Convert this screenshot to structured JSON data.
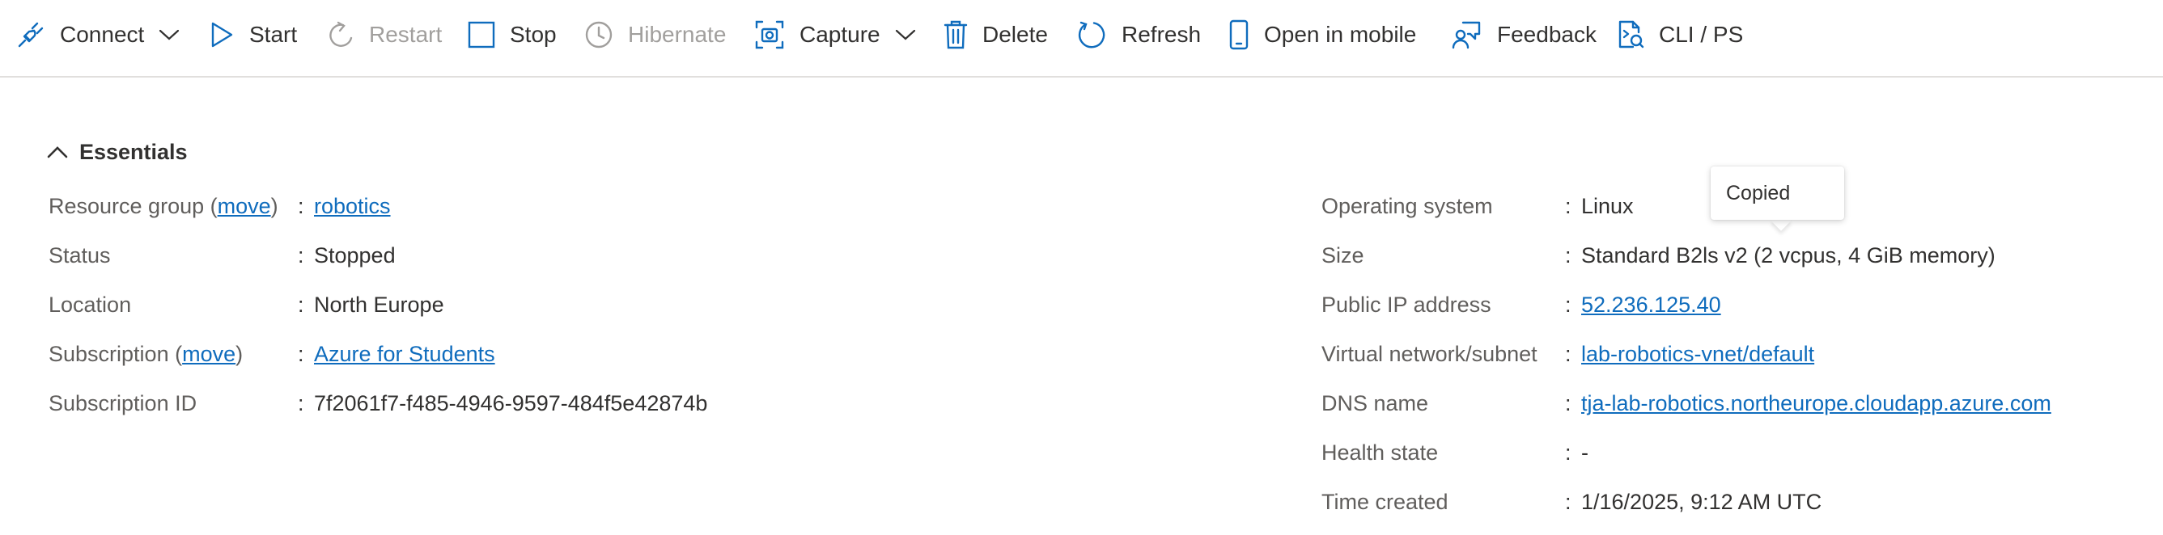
{
  "toolbar": {
    "connect": "Connect",
    "start": "Start",
    "restart": "Restart",
    "stop": "Stop",
    "hibernate": "Hibernate",
    "capture": "Capture",
    "delete": "Delete",
    "refresh": "Refresh",
    "open_in_mobile": "Open in mobile",
    "feedback": "Feedback",
    "cli_ps": "CLI / PS"
  },
  "essentials": {
    "title": "Essentials",
    "left": {
      "resource_group": {
        "label": "Resource group",
        "move": "move",
        "value": "robotics"
      },
      "status": {
        "label": "Status",
        "value": "Stopped"
      },
      "location": {
        "label": "Location",
        "value": "North Europe"
      },
      "subscription": {
        "label": "Subscription",
        "move": "move",
        "value": "Azure for Students"
      },
      "subscription_id": {
        "label": "Subscription ID",
        "value": "7f2061f7-f485-4946-9597-484f5e42874b"
      }
    },
    "right": {
      "os": {
        "label": "Operating system",
        "value": "Linux"
      },
      "size": {
        "label": "Size",
        "value": "Standard B2ls v2 (2 vcpus, 4 GiB memory)"
      },
      "public_ip": {
        "label": "Public IP address",
        "value": "52.236.125.40"
      },
      "vnet": {
        "label": "Virtual network/subnet",
        "value": "lab-robotics-vnet/default"
      },
      "dns": {
        "label": "DNS name",
        "value": "tja-lab-robotics.northeurope.cloudapp.azure.com"
      },
      "health": {
        "label": "Health state",
        "value": "-"
      },
      "time_created": {
        "label": "Time created",
        "value": "1/16/2025, 9:12 AM UTC"
      }
    }
  },
  "colon": ":",
  "tooltip": {
    "text": "Copied"
  },
  "colors": {
    "link": "#0f6cbd",
    "icon": "#0f6cbd",
    "disabled": "#a19f9d",
    "text": "#323130",
    "label": "#605e5c"
  },
  "icons": [
    "plug-icon",
    "play-icon",
    "restart-icon",
    "stop-square-icon",
    "clock-icon",
    "capture-icon",
    "trash-icon",
    "refresh-icon",
    "mobile-icon",
    "feedback-icon",
    "cli-icon",
    "chevron-down-icon",
    "chevron-up-icon"
  ]
}
